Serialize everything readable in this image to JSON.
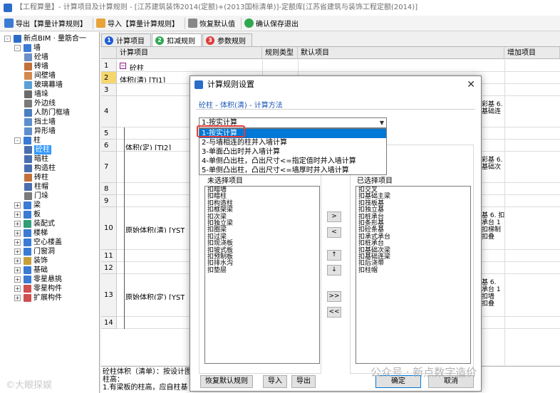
{
  "window": {
    "title": "【工程算量】- 计算项目及计算规则 - [江苏建筑装饰2014(定额)+(2013国标清单)]-定额库[江苏省建筑与装饰工程定额(2014)]"
  },
  "toolbar": [
    {
      "label": "导出【算量计算规则】",
      "icon": "export-icon",
      "color": "#3a7bd5"
    },
    {
      "label": "导入【算量计算规则】",
      "icon": "import-icon",
      "color": "#e8a33a"
    },
    {
      "label": "恢复默认值",
      "icon": "restore-icon",
      "color": "#888888"
    },
    {
      "label": "确认保存退出",
      "icon": "confirm-icon",
      "color": "#2fa84f"
    }
  ],
  "tree": [
    {
      "label": "新点BIM · 量筋合一",
      "level": 0,
      "exp": "-",
      "icon": "app-icon",
      "color": "#2b6cc9"
    },
    {
      "label": "墙",
      "level": 1,
      "exp": "-",
      "icon": "wall-icon",
      "color": "#3a7bd5"
    },
    {
      "label": "砼墙",
      "level": 2,
      "exp": "",
      "icon": "concrete-wall-icon",
      "color": "#6b8fc7"
    },
    {
      "label": "砖墙",
      "level": 2,
      "exp": "",
      "icon": "brick-wall-icon",
      "color": "#c2703a"
    },
    {
      "label": "间壁墙",
      "level": 2,
      "exp": "",
      "icon": "partition-wall-icon",
      "color": "#d28b4e"
    },
    {
      "label": "玻璃幕墙",
      "level": 2,
      "exp": "",
      "icon": "curtain-wall-icon",
      "color": "#5aa0d8"
    },
    {
      "label": "墙垛",
      "level": 2,
      "exp": "",
      "icon": "wall-pier-icon",
      "color": "#6b6b6b"
    },
    {
      "label": "外边线",
      "level": 2,
      "exp": "",
      "icon": "outline-icon",
      "color": "#7a7a7a"
    },
    {
      "label": "人防门框墙",
      "level": 2,
      "exp": "",
      "icon": "door-frame-wall-icon",
      "color": "#4a7fc0"
    },
    {
      "label": "挡土墙",
      "level": 2,
      "exp": "",
      "icon": "retaining-wall-icon",
      "color": "#5d8fcf"
    },
    {
      "label": "异形墙",
      "level": 2,
      "exp": "",
      "icon": "irregular-wall-icon",
      "color": "#5d8fcf"
    },
    {
      "label": "柱",
      "level": 1,
      "exp": "-",
      "icon": "column-icon",
      "color": "#3a7bd5"
    },
    {
      "label": "砼柱",
      "level": 2,
      "exp": "",
      "icon": "concrete-column-icon",
      "color": "#4a6fb0",
      "selected": true
    },
    {
      "label": "暗柱",
      "level": 2,
      "exp": "",
      "icon": "hidden-column-icon",
      "color": "#4a6fb0"
    },
    {
      "label": "构造柱",
      "level": 2,
      "exp": "",
      "icon": "structural-column-icon",
      "color": "#4a6fb0"
    },
    {
      "label": "砖柱",
      "level": 2,
      "exp": "",
      "icon": "brick-column-icon",
      "color": "#c2703a"
    },
    {
      "label": "柱帽",
      "level": 2,
      "exp": "",
      "icon": "column-cap-icon",
      "color": "#4a6fb0"
    },
    {
      "label": "门垛",
      "level": 2,
      "exp": "",
      "icon": "door-pier-icon",
      "color": "#7a7a7a"
    },
    {
      "label": "梁",
      "level": 1,
      "exp": "+",
      "icon": "beam-icon",
      "color": "#3a7bd5"
    },
    {
      "label": "板",
      "level": 1,
      "exp": "+",
      "icon": "slab-icon",
      "color": "#3a7bd5"
    },
    {
      "label": "装配式",
      "level": 1,
      "exp": "+",
      "icon": "prefab-icon",
      "color": "#2f9f7a"
    },
    {
      "label": "楼梯",
      "level": 1,
      "exp": "+",
      "icon": "stair-icon",
      "color": "#3a7bd5"
    },
    {
      "label": "空心楼盖",
      "level": 1,
      "exp": "+",
      "icon": "hollow-floor-icon",
      "color": "#3a7bd5"
    },
    {
      "label": "门窗洞",
      "level": 1,
      "exp": "+",
      "icon": "door-window-icon",
      "color": "#3a7bd5"
    },
    {
      "label": "装饰",
      "level": 1,
      "exp": "+",
      "icon": "decoration-icon",
      "color": "#c7a03a"
    },
    {
      "label": "基础",
      "level": 1,
      "exp": "+",
      "icon": "foundation-icon",
      "color": "#3a7bd5"
    },
    {
      "label": "零星悬挑",
      "level": 1,
      "exp": "+",
      "icon": "cantilever-icon",
      "color": "#3a7bd5"
    },
    {
      "label": "零星构件",
      "level": 1,
      "exp": "+",
      "icon": "misc-component-icon",
      "color": "#d05050"
    },
    {
      "label": "扩展构件",
      "level": 1,
      "exp": "+",
      "icon": "extended-component-icon",
      "color": "#d05050"
    }
  ],
  "tabs": [
    {
      "num": "1",
      "label": "计算项目",
      "color": "#1e5bd7",
      "active": false
    },
    {
      "num": "2",
      "label": "扣减规则",
      "color": "#2fa84f",
      "active": true
    },
    {
      "num": "3",
      "label": "参数规则",
      "color": "#e03a3a",
      "active": false
    }
  ],
  "grid": {
    "headers": [
      "计算项目",
      "规则类型",
      "默认项目",
      "增加项目"
    ],
    "row_numbers": [
      "1",
      "2",
      "3",
      "4",
      "5",
      "6",
      "7",
      "8",
      "9",
      "10",
      "11",
      "12",
      "13",
      "14"
    ],
    "current_row": "2",
    "cells": {
      "r1_item": "砼柱",
      "r2_item": "体积(清) [TJ1]",
      "r2_type": "计算方法",
      "r2_default": "1-按实计算",
      "r6_item": "体积(定) [TJ2]",
      "r10_item": "原始体积(清) [YST",
      "r13_item": "原始体积(定) [YST"
    },
    "right_fragments": [
      {
        "text": "彩基 6.",
        "row": 4
      },
      {
        "text": "基础连",
        "row": 4
      },
      {
        "text": "彩基 6.",
        "row": 7
      },
      {
        "text": "基础次",
        "row": 7
      },
      {
        "text": "基 6. 扣",
        "row": 10
      },
      {
        "text": "承台 1",
        "row": 10
      },
      {
        "text": "扣梯制",
        "row": 10
      },
      {
        "text": "扣叠",
        "row": 10
      },
      {
        "text": "基 6.",
        "row": 13
      },
      {
        "text": "承台 1",
        "row": 13
      },
      {
        "text": "扣墙",
        "row": 13
      },
      {
        "text": "扣叠",
        "row": 13
      }
    ]
  },
  "bottom_text": [
    "砼柱体积（清单）：按设计图",
    "柱高：",
    "1.有梁板的柱高，应自柱基"
  ],
  "dialog": {
    "title": "计算规则设置",
    "close": "✕",
    "subtitle": "砼柱 - 体积(清) - 计算方法",
    "combo_value": "1-按实计算",
    "dropdown_items": [
      "1-按实计算",
      "2-与墙相连的柱并入墙计算",
      "3-单面凸出时并入墙计算",
      "4-单侧凸出柱，凸出尺寸<=指定值时并入墙计算",
      "5-单侧凸出柱，凸出尺寸<=墙厚时并入墙计算"
    ],
    "selected_index": 0,
    "unselected_label": "未选择项目",
    "selected_label": "已选择项目",
    "unselected_items": [
      "扣暗墙",
      "扣暗柱",
      "扣构造柱",
      "扣框架梁",
      "扣次梁",
      "扣独立梁",
      "扣圈梁",
      "扣过梁",
      "扣现浇板",
      "扣坡式板",
      "扣预制板",
      "扣排水沟",
      "扣垫层"
    ],
    "selected_items": [
      "扣交叉",
      "扣基础主梁",
      "扣筏板基",
      "扣独立基",
      "扣桩承台",
      "扣条形基",
      "扣砼条基",
      "扣承式承台",
      "扣桩承台",
      "扣基础次梁",
      "扣基础连梁",
      "扣后浇带",
      "扣柱帽"
    ],
    "mid_buttons": [
      ">",
      "<",
      "↑",
      "↓",
      ">>",
      "<<"
    ],
    "buttons": {
      "restore": "恢复默认规则",
      "import": "导入",
      "export": "导出",
      "ok": "确定",
      "cancel": "取消"
    }
  },
  "watermarks": {
    "left": "©大眼探娱",
    "right": "公众号 · 新点数字造价"
  }
}
